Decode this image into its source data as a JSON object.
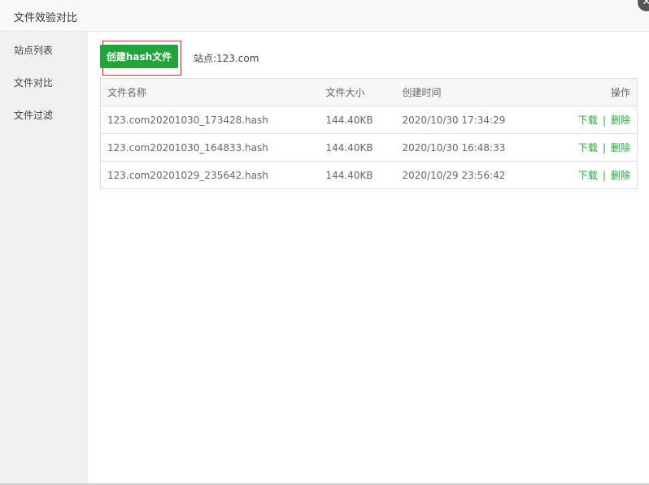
{
  "dialog": {
    "title": "文件效验对比",
    "close_icon": "close-icon"
  },
  "sidebar": {
    "items": [
      {
        "label": "站点列表"
      },
      {
        "label": "文件对比"
      },
      {
        "label": "文件过滤"
      }
    ]
  },
  "toolbar": {
    "create_button_label": "创建hash文件",
    "site_label": "站点:",
    "site_value": "123.com"
  },
  "table": {
    "headers": {
      "name": "文件名称",
      "size": "文件大小",
      "created": "创建时间",
      "actions": "操作"
    },
    "rows": [
      {
        "name": "123.com20201030_173428.hash",
        "size": "144.40KB",
        "created": "2020/10/30 17:34:29",
        "download": "下载",
        "sep": "|",
        "delete": "删除"
      },
      {
        "name": "123.com20201030_164833.hash",
        "size": "144.40KB",
        "created": "2020/10/30 16:48:33",
        "download": "下载",
        "sep": "|",
        "delete": "删除"
      },
      {
        "name": "123.com20201029_235642.hash",
        "size": "144.40KB",
        "created": "2020/10/29 23:56:42",
        "download": "下载",
        "sep": "|",
        "delete": "删除"
      }
    ]
  },
  "colors": {
    "accent": "#20a53a",
    "highlight_border": "#e02424"
  }
}
